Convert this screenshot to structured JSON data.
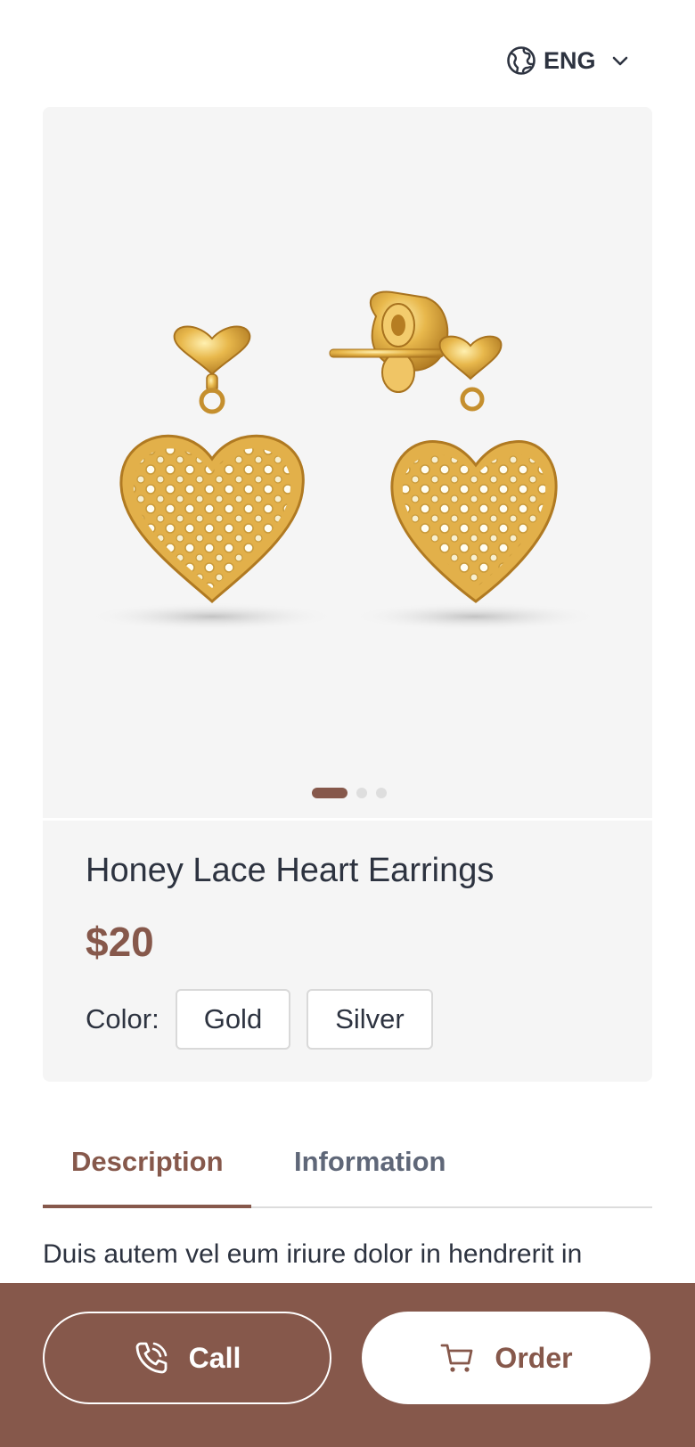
{
  "header": {
    "language_label": "ENG",
    "language_icon": "globe-icon",
    "dropdown_icon": "chevron-down-icon"
  },
  "product": {
    "title": "Honey Lace Heart Earrings",
    "price": "$20",
    "color_label": "Color:",
    "colors": [
      "Gold",
      "Silver"
    ],
    "carousel": {
      "total_slides": 3,
      "active_slide": 1
    }
  },
  "tabs": {
    "description": "Description",
    "information": "Information",
    "active": "description"
  },
  "description_text": "Duis autem vel eum iriure dolor in hendrerit in vulputate velit esse molestie consequat, vel",
  "actions": {
    "call_label": "Call",
    "call_icon": "phone-icon",
    "order_label": "Order",
    "order_icon": "cart-icon"
  },
  "colors": {
    "accent": "#86584b",
    "text": "#2d3340",
    "card_bg": "#f5f5f5",
    "gold": "#e3b548"
  }
}
